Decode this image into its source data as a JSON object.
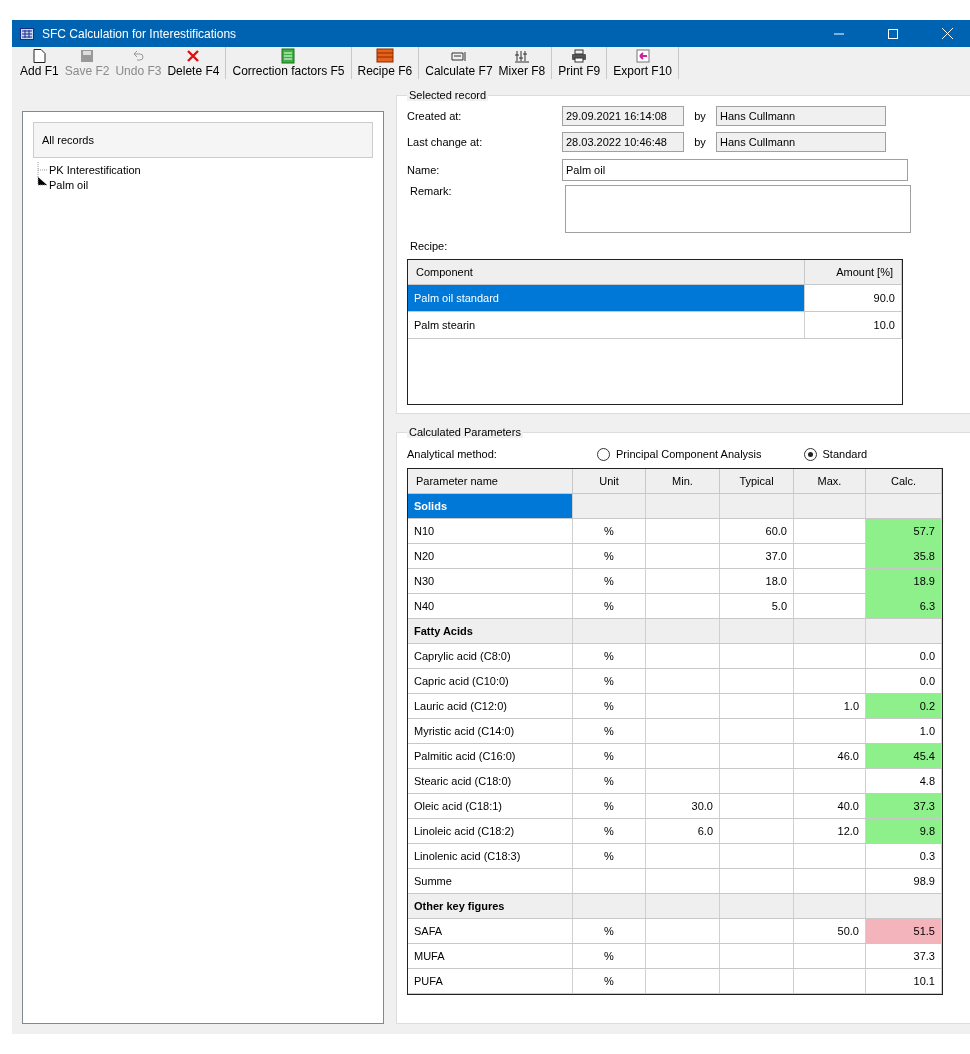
{
  "window": {
    "title": "SFC Calculation for Interestifications"
  },
  "toolbar": [
    {
      "label": "Add F1",
      "disabled": false
    },
    {
      "label": "Save F2",
      "disabled": true
    },
    {
      "label": "Undo F3",
      "disabled": true
    },
    {
      "label": "Delete F4",
      "disabled": false
    },
    {
      "label": "Correction factors F5",
      "disabled": false
    },
    {
      "label": "Recipe F6",
      "disabled": false
    },
    {
      "label": "Calculate F7",
      "disabled": false
    },
    {
      "label": "Mixer F8",
      "disabled": false
    },
    {
      "label": "Print F9",
      "disabled": false
    },
    {
      "label": "Export F10",
      "disabled": false
    }
  ],
  "records": {
    "header": "All records",
    "items": [
      {
        "label": "PK Interestification",
        "selected": false
      },
      {
        "label": "Palm oil",
        "selected": false
      }
    ]
  },
  "selected_record": {
    "title": "Selected record",
    "created_label": "Created at:",
    "created_at": "29.09.2021 16:14:08",
    "created_by_label": "by",
    "created_by": "Hans Cullmann",
    "changed_label": "Last change at:",
    "changed_at": "28.03.2022 10:46:48",
    "changed_by_label": "by",
    "changed_by": "Hans Cullmann",
    "name_label": "Name:",
    "name": "Palm oil",
    "remark_label": "Remark:",
    "recipe_label": "Recipe:",
    "recipe_columns": [
      "Component",
      "Amount [%]"
    ],
    "recipe_rows": [
      {
        "component": "Palm oil standard",
        "amount": "90.0",
        "selected": true
      },
      {
        "component": "Palm stearin",
        "amount": "10.0",
        "selected": false
      }
    ]
  },
  "calculated": {
    "title": "Calculated Parameters",
    "method_label": "Analytical method:",
    "methods": [
      {
        "label": "Principal Component Analysis",
        "selected": false
      },
      {
        "label": "Standard",
        "selected": true
      }
    ],
    "columns": [
      "Parameter name",
      "Unit",
      "Min.",
      "Typical",
      "Max.",
      "Calc."
    ],
    "rows": [
      {
        "kind": "section",
        "name": "Solids",
        "selected": true
      },
      {
        "kind": "param",
        "name": "N10",
        "unit": "%",
        "typical": "60.0",
        "calc": "57.7",
        "color": "#8ef08a"
      },
      {
        "kind": "param",
        "name": "N20",
        "unit": "%",
        "typical": "37.0",
        "calc": "35.8",
        "color": "#8ef08a"
      },
      {
        "kind": "param",
        "name": "N30",
        "unit": "%",
        "typical": "18.0",
        "calc": "18.9",
        "color": "#8ef08a"
      },
      {
        "kind": "param",
        "name": "N40",
        "unit": "%",
        "typical": "5.0",
        "calc": "6.3",
        "color": "#8ef08a"
      },
      {
        "kind": "section",
        "name": "Fatty Acids",
        "selected": false
      },
      {
        "kind": "param",
        "name": "Caprylic acid (C8:0)",
        "unit": "%",
        "calc": "0.0"
      },
      {
        "kind": "param",
        "name": "Capric acid (C10:0)",
        "unit": "%",
        "calc": "0.0"
      },
      {
        "kind": "param",
        "name": "Lauric acid (C12:0)",
        "unit": "%",
        "max": "1.0",
        "calc": "0.2",
        "color": "#8ef08a"
      },
      {
        "kind": "param",
        "name": "Myristic acid (C14:0)",
        "unit": "%",
        "calc": "1.0"
      },
      {
        "kind": "param",
        "name": "Palmitic acid (C16:0)",
        "unit": "%",
        "max": "46.0",
        "calc": "45.4",
        "color": "#8ef08a"
      },
      {
        "kind": "param",
        "name": "Stearic acid (C18:0)",
        "unit": "%",
        "calc": "4.8"
      },
      {
        "kind": "param",
        "name": "Oleic acid (C18:1)",
        "unit": "%",
        "min": "30.0",
        "max": "40.0",
        "calc": "37.3",
        "color": "#8ef08a"
      },
      {
        "kind": "param",
        "name": "Linoleic acid (C18:2)",
        "unit": "%",
        "min": "6.0",
        "max": "12.0",
        "calc": "9.8",
        "color": "#8ef08a"
      },
      {
        "kind": "param",
        "name": "Linolenic acid (C18:3)",
        "unit": "%",
        "calc": "0.3"
      },
      {
        "kind": "param",
        "name": "Summe",
        "calc": "98.9"
      },
      {
        "kind": "section",
        "name": "Other key figures",
        "selected": false
      },
      {
        "kind": "param",
        "name": "SAFA",
        "unit": "%",
        "max": "50.0",
        "calc": "51.5",
        "color": "#f4b4bc"
      },
      {
        "kind": "param",
        "name": "MUFA",
        "unit": "%",
        "calc": "37.3"
      },
      {
        "kind": "param",
        "name": "PUFA",
        "unit": "%",
        "calc": "10.1"
      }
    ]
  }
}
